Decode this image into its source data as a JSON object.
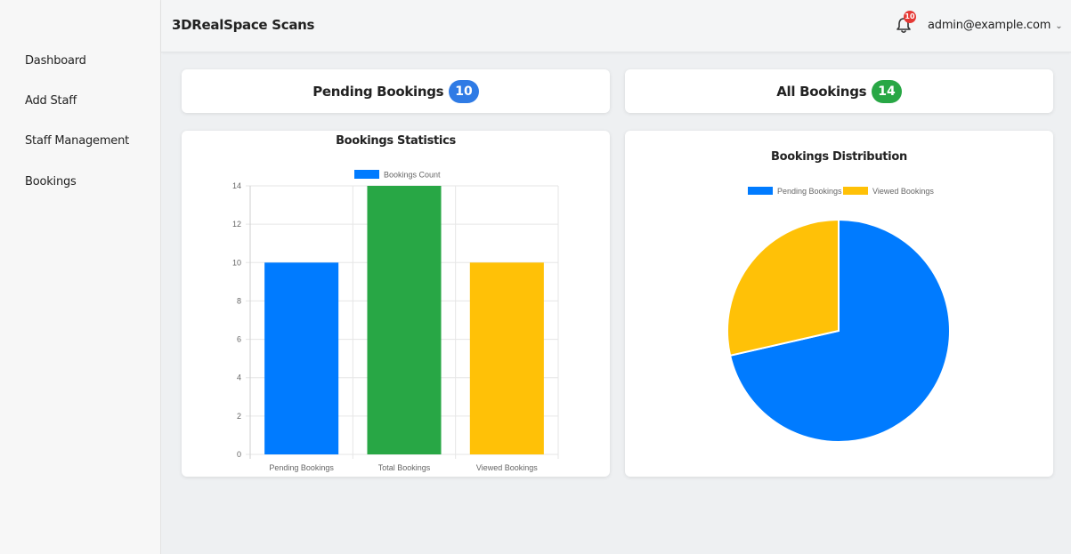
{
  "sidebar": {
    "items": [
      {
        "label": "Dashboard"
      },
      {
        "label": "Add Staff"
      },
      {
        "label": "Staff Management"
      },
      {
        "label": "Bookings"
      }
    ]
  },
  "header": {
    "title": "3DRealSpace Scans",
    "notification_count": "10",
    "user_email": "admin@example.com"
  },
  "stats": {
    "pending": {
      "label": "Pending Bookings",
      "count": "10",
      "color": "#2f7be5"
    },
    "all": {
      "label": "All Bookings",
      "count": "14",
      "color": "#28a745"
    }
  },
  "colors": {
    "blue": "#007bff",
    "green": "#28a745",
    "yellow": "#ffc107"
  },
  "chart_data": [
    {
      "type": "bar",
      "title": "Bookings Statistics",
      "categories": [
        "Pending Bookings",
        "Total Bookings",
        "Viewed Bookings"
      ],
      "series": [
        {
          "name": "Bookings Count",
          "values": [
            10,
            14,
            10
          ]
        }
      ],
      "bar_colors": [
        "#007bff",
        "#28a745",
        "#ffc107"
      ],
      "ylim": [
        0,
        14
      ],
      "yticks": [
        0,
        2,
        4,
        6,
        8,
        10,
        12,
        14
      ],
      "grid": true,
      "legend": "top"
    },
    {
      "type": "pie",
      "title": "Bookings Distribution",
      "labels": [
        "Pending Bookings",
        "Viewed Bookings"
      ],
      "values": [
        10,
        4
      ],
      "colors": [
        "#007bff",
        "#ffc107"
      ],
      "legend": "top"
    }
  ]
}
